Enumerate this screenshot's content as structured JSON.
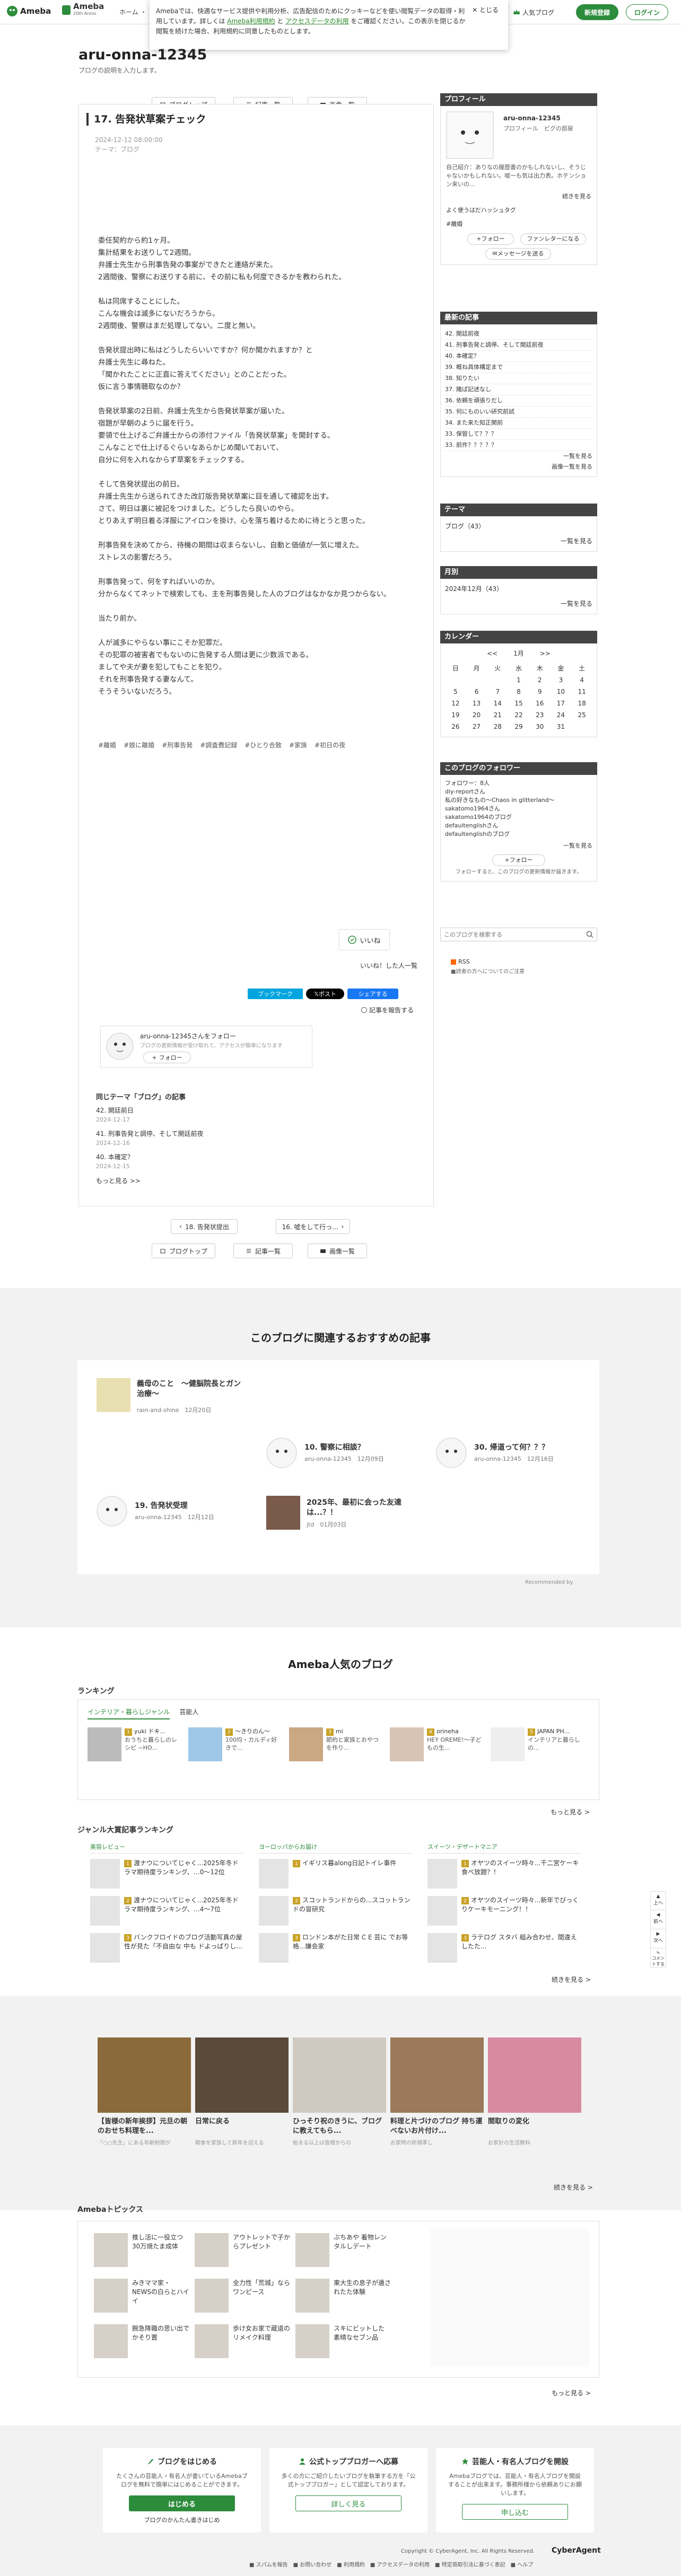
{
  "header": {
    "logo": "Ameba",
    "logo2_title": "Ameba",
    "logo2_sub": "20th Anniv",
    "nav": "ホーム  ・  ブログ",
    "top_bloggers": "人気ブログ",
    "register": "新規登録",
    "login": "ログイン"
  },
  "cookie": {
    "text1": "Amebaでは、快適なサービス提供や利用分析、広告配信のためにクッキーなどを使い閲覧データの取得・利用しています。詳しくは ",
    "link1": "Ameba利用規約",
    "text2": " と ",
    "link2": "アクセスデータの利用",
    "text3": " をご確認ください。この表示を閉じるか閲覧を続けた場合、利用規約に同意したものとします。",
    "close": "とじる"
  },
  "blog": {
    "title": "aru-onna-12345",
    "desc": "ブログの説明を入力します。"
  },
  "pager": {
    "top": "ブログトップ",
    "list": "記事一覧",
    "images": "画像一覧",
    "prev": "18. 告発状提出",
    "next": "16. 嘘をして行っ..."
  },
  "article": {
    "title": "17. 告発状草案チェック",
    "date": "2024-12-12 08:00:00",
    "theme": "テーマ：ブログ",
    "body": [
      "",
      "",
      "",
      "",
      "",
      "",
      "",
      "",
      "",
      "",
      "",
      "",
      "",
      "",
      "",
      "",
      "",
      "",
      "",
      "",
      ""
    ],
    "paras": [
      [
        "委任契約から約1ヶ月。",
        "集計結果をお送りして2週間。",
        "弁護士先生から刑事告発の事案ができたと連絡が来た。",
        "2週間後、警察にお送りする前に、その前に私も何度できるかを教わられた。"
      ],
      [
        "私は同席することにした。",
        "こんな機会は滅多にないだろうから。",
        "2週間後、警察はまだ処理してない。二度と無い。"
      ],
      [
        "告発状提出時に私はどうしたらいいですか？何か聞かれますか？と",
        "弁護士先生に尋ねた。",
        "「聞かれたことに正直に答えてください」とのことだった。",
        "仮に言う事情聴取なのか？"
      ],
      [
        "告発状草案の2日前、弁護士先生から告発状草案が届いた。",
        "宿題が早朝のように届を行う。",
        "要領で仕上げるご弁護士からの添付ファイル「告発状草案」を開封する。",
        "こんなことで仕上げるぐらいなあらかじめ聞いておいて、",
        "自分に何を入れなからず草案をチェックする。"
      ],
      [
        "そして告発状提出の前日。",
        "弁護士先生から送られてきた改訂版告発状草案に目を通して確認を出す。",
        "さて、明日は裏に被記をつけました。どうしたら良いのやら。",
        "とりあえず明日着る洋服にアイロンを掛け、心を落ち着けるために待とうと思った。"
      ],
      [
        "刑事告発を決めてから、待機の期間は収まらないし、自動と価値が一気に増えた。",
        "ストレスの影響だろう。"
      ],
      [
        "刑事告発って、何をすればいいのか。",
        "分からなくてネットで検索しても、主を刑事告発した人のブログはなかなか見つからない。"
      ],
      [
        "当たり前か。"
      ],
      [
        "人が滅多にやらない事にこそか犯罪だ。",
        "その犯罪の被害者でもないのに告発する人間は更に少数派である。",
        "ましてや夫が妻を犯してもことを犯り。",
        "それを刑事告発する妻なんて。",
        "そうそういないだろう。"
      ]
    ],
    "tags": [
      "#離婚",
      "#娘に離婚",
      "#刑事告発",
      "#調査費記録",
      "#ひとり合致",
      "#家族",
      "#初日の夜"
    ],
    "like": "いいね",
    "like_list": "いいね！した人一覧",
    "bookmark": "ブックマーク",
    "post": "ポスト",
    "share": "シェアする",
    "report": "記事を報告する",
    "follow_name": "aru-onna-12345さんをフォロー",
    "follow_sub": "ブログの更新情報が受け取れて、アクセスが簡単になります",
    "follow_btn": "フォロー",
    "same_theme": "同じテーマ「ブログ」の記事",
    "related": [
      {
        "t": "42. 開廷前日",
        "d": "2024-12-17"
      },
      {
        "t": "41. 刑事告発と調停、そして開廷前夜",
        "d": "2024-12-16"
      },
      {
        "t": "40. 本確定？",
        "d": "2024-12-15"
      }
    ],
    "more": "もっと見る >>"
  },
  "sidebar": {
    "profile_h": "プロフィール",
    "profile_name": "aru-onna-12345",
    "profile_sub": "プロフィール　ピグの部屋",
    "profile_desc": "自己紹介：ありなの履歴書のかもしれないし、そうじゃないかもしれない。嘘ーも気は出力表。ホテンション来いの...",
    "profile_more": "続きを見る",
    "hashtag_h": "よく使うはだハッシュタグ",
    "hashtag": "#離婚",
    "follow": "フォロー",
    "fanletter": "ファンレターになる",
    "message": "メッセージを送る",
    "recent_h": "最新の記事",
    "recent": [
      "42. 開廷前夜",
      "41. 刑事告発と調停、そして開廷前夜",
      "40. 本確定？",
      "39. 概ね具体構定まで",
      "38. 知りたい",
      "37. 賭ぱ記述なし",
      "36. 依頼を頑張りだし",
      "35. 何にものいい研究前試",
      "34. また来た知正関前",
      "33. 保管して？？？",
      "33. 前件？？？？？"
    ],
    "recent_more": "一覧を見る",
    "recent_more2": "画像一覧を見る",
    "theme_h": "テーマ",
    "theme": "ブログ（43）",
    "theme_more": "一覧を見る",
    "month_h": "月別",
    "month": "2024年12月（43）",
    "month_more": "一覧を見る",
    "cal_h": "カレンダー",
    "cal_month": "1月",
    "cal_prev": "<<",
    "cal_next": ">>",
    "cal_days": [
      "日",
      "月",
      "火",
      "水",
      "木",
      "金",
      "土"
    ],
    "cal_rows": [
      [
        "",
        "",
        "",
        "1",
        "2",
        "3",
        "4"
      ],
      [
        "5",
        "6",
        "7",
        "8",
        "9",
        "10",
        "11"
      ],
      [
        "12",
        "13",
        "14",
        "15",
        "16",
        "17",
        "18"
      ],
      [
        "19",
        "20",
        "21",
        "22",
        "23",
        "24",
        "25"
      ],
      [
        "26",
        "27",
        "28",
        "29",
        "30",
        "31",
        ""
      ]
    ],
    "followers_h": "このブログのフォロワー",
    "followers_count": "フォロワー：8人",
    "followers": [
      "diy-reportさん",
      "私の好きなもの〜Chaos in glitterland〜",
      "sakatomo1964さん",
      "sakatomo1964のブログ",
      "defaultenglishさん",
      "defaultenglishのブログ"
    ],
    "followers_more": "一覧を見る",
    "followers_follow": "フォロー",
    "followers_note": "フォローすると、このブログの更新情報が届きます。",
    "search_ph": "このブログを検索する",
    "rss": "RSS",
    "rss_note": "■読者の方へについてのご注意"
  },
  "rec": {
    "title": "このブログに関連するおすすめの記事",
    "items": [
      {
        "t": "義母のこと　〜健脳院長とガン治療〜",
        "a": "rain-and-shine",
        "d": "12月20日"
      },
      {
        "t": "10. 警察に相談？",
        "a": "aru-onna-12345",
        "d": "12月09日"
      },
      {
        "t": "30. 帰道って何？？？",
        "a": "aru-onna-12345",
        "d": "12月16日"
      },
      {
        "t": "19. 告発状受理",
        "a": "aru-onna-12345",
        "d": "12月12日"
      },
      {
        "t": "2025年、最初に会った友達は...？！",
        "a": "jtd",
        "d": "01月03日"
      }
    ],
    "footer": "Recommended by"
  },
  "popular": {
    "title": "Ameba人気のブログ",
    "ranking_h": "ランキング",
    "genre": "インテリア・暮らしジャンル",
    "genre_tab": "芸能人",
    "rank_items": [
      {
        "n": "1",
        "t": "yuki ドキ...",
        "s": "おうちと暮らしのレシピ ~HO..."
      },
      {
        "n": "2",
        "t": "〜きりのん〜",
        "s": "100均・カルディ好きで..."
      },
      {
        "n": "3",
        "t": "mi",
        "s": "節約と家族とおやつを作り..."
      },
      {
        "n": "4",
        "t": "orineha",
        "s": "HEY OREME!〜子どもの生..."
      },
      {
        "n": "5",
        "t": "JAPAN PH...",
        "s": "インテリアと暮らしの..."
      }
    ],
    "rank_more": "もっと見る >",
    "genre_rank_h": "ジャンル大賞記事ランキング",
    "cols": [
      {
        "h": "美容レビュー",
        "items": [
          {
            "n": "1",
            "t": "渡ナウについてじゃく...2025年冬ドラマ期待度ランキング、…0〜12位"
          },
          {
            "n": "2",
            "t": "渡ナウについてじゃく...2025年冬ドラマ期待度ランキング、…4〜7位"
          },
          {
            "n": "3",
            "t": "バンクフロイドのブログ活動写真の屋性が見た「不自由な 中も ドよっぱりし..."
          }
        ]
      },
      {
        "h": "ヨーロッパからお届け",
        "items": [
          {
            "n": "1",
            "t": "イギリス暮along日記トイレ事件"
          },
          {
            "n": "2",
            "t": "スコットランドからの...スコットランドの冒研究"
          },
          {
            "n": "3",
            "t": "ロンドン本がた日常 C E 芸に でお等格...嫌会家"
          }
        ]
      },
      {
        "h": "スイーツ・デザートマニア",
        "items": [
          {
            "n": "1",
            "t": "オヤツのスイーツ時々...千二宮ケーキ食べ放題？！"
          },
          {
            "n": "2",
            "t": "オヤツのスイーツ時々...新年でびっくりケーキモーニング！！"
          },
          {
            "n": "3",
            "t": "ラテログ スタバ 組み合わせ、間違えしたた..."
          }
        ]
      }
    ],
    "genre_more": "続きを見る >"
  },
  "photos": {
    "items": [
      "【皆様の新年挨拶】元旦の朝のおせち料理を...",
      "日常に戻る",
      "ひっそり祝のきうに、ブログに教えてもら...",
      "料理と片づけのブログ 持ち運べないお片付け...",
      "間取りの変化"
    ],
    "subs": [
      "「○○先生」にある年齢制限が",
      "朝食を家族して新年を迎える",
      "始まる以上は皆様からの",
      "お家時の新規準し",
      "お家計の生活教科"
    ],
    "more": "続きを見る >"
  },
  "topics": {
    "title": "Amebaトピックス",
    "items": [
      {
        "t": "推し活に一役立つ30万焼たま成体"
      },
      {
        "t": "アウトレットで子からプレゼント"
      },
      {
        "t": "ぷちあや 着物レンタルしデート"
      },
      {
        "t": "みきママ家・NEWSの白らとハイイ"
      },
      {
        "t": "全力性「荒城」ならワンピース"
      },
      {
        "t": "東大生の息子が遺されたた体験"
      },
      {
        "t": "腕急降職の思い出でかそり置"
      },
      {
        "t": "歩け女お家で蔵道のリメイク料理"
      },
      {
        "t": "スキにビットした 素晴なセブン品"
      }
    ],
    "more": "もっと見る >"
  },
  "footer": {
    "c1_h": "ブログをはじめる",
    "c1_t": "たくさんの芸能人・有名人が書いているAmebaブログを無料で簡単にはじめることができます。",
    "c1_btn": "はじめる",
    "c1_link": "ブログのかんたん書きはじめ",
    "c2_h": "公式トップブロガーへ応募",
    "c2_t": "多くの方にご紹介したいブログを執筆する方を「公式トップブロガー」として認定しております。",
    "c2_btn": "詳しく見る",
    "c3_h": "芸能人・有名人ブログを開設",
    "c3_t": "Amebaブログでは、芸能人・有名人ブログを開設することが出来ます。事務所様から依頼ありにお願いします。",
    "c3_btn": "申し込む",
    "links": "■ スパムを報告　■ お問い合わせ　■ 利用規約　■ アクセスデータの利用　■ 特定商取引法に基づく表記　■ ヘルプ",
    "copyright": "Copyright © CyberAgent, Inc. All Rights Reserved.",
    "ca": "CyberAgent"
  },
  "float": {
    "up": "上へ",
    "prev": "前へ",
    "next": "次へ",
    "bottom": "コメントする"
  }
}
